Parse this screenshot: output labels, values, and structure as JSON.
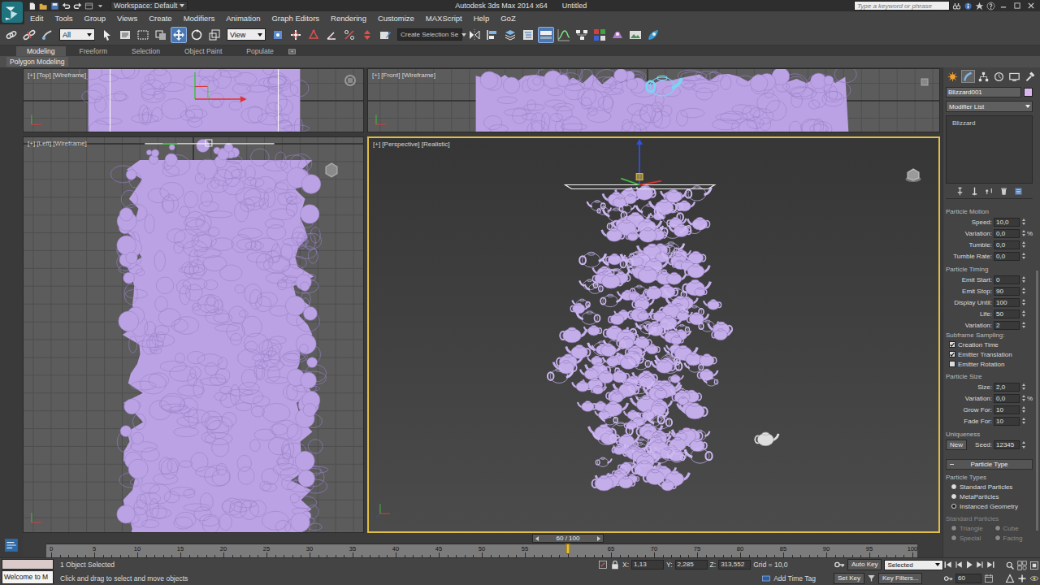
{
  "title_bar": {
    "workspace": "Workspace: Default",
    "app_title": "Autodesk 3ds Max 2014 x64",
    "document": "Untitled",
    "search_placeholder": "Type a keyword or phrase"
  },
  "menu": [
    "Edit",
    "Tools",
    "Group",
    "Views",
    "Create",
    "Modifiers",
    "Animation",
    "Graph Editors",
    "Rendering",
    "Customize",
    "MAXScript",
    "Help",
    "GoZ"
  ],
  "toolbar": {
    "selection_filter": "All",
    "reference_coord": "View",
    "named_selection": "Create Selection Se",
    "tools": [
      {
        "selected": false
      },
      {
        "selected": false
      },
      {
        "selected": false
      },
      {
        "selected": false
      },
      {
        "selected": false
      },
      {
        "selected": false
      },
      {
        "selected": false
      },
      {
        "selected": true
      },
      {
        "selected": false
      },
      {
        "selected": false
      },
      {
        "selected": false
      },
      {
        "selected": false
      },
      {
        "selected": false
      },
      {
        "selected": false
      },
      {
        "selected": false
      },
      {
        "selected": false
      },
      {
        "selected": false
      },
      {
        "selected": false
      },
      {
        "selected": false
      },
      {
        "selected": false
      },
      {
        "selected": false
      },
      {
        "selected": true
      },
      {
        "selected": false
      },
      {
        "selected": false
      },
      {
        "selected": false
      },
      {
        "selected": false
      },
      {
        "selected": false
      },
      {
        "selected": false
      }
    ]
  },
  "ribbon": {
    "tabs": [
      {
        "label": "Modeling",
        "selected": true
      },
      {
        "label": "Freeform",
        "selected": false
      },
      {
        "label": "Selection",
        "selected": false
      },
      {
        "label": "Object Paint",
        "selected": false
      },
      {
        "label": "Populate",
        "selected": false
      }
    ],
    "panel": "Polygon Modeling"
  },
  "viewports": [
    {
      "label": "[+] [Top] [Wireframe]",
      "active": false
    },
    {
      "label": "[+] [Front] [Wireframe]",
      "active": false
    },
    {
      "label": "[+] [Left] [Wireframe]",
      "active": false
    },
    {
      "label": "[+] [Perspective] [Realistic]",
      "active": true
    }
  ],
  "command_panel": {
    "tabs": [
      {
        "selected": false
      },
      {
        "selected": true
      },
      {
        "selected": false
      },
      {
        "selected": false
      },
      {
        "selected": false
      },
      {
        "selected": false
      }
    ],
    "object_name": "Blizzard001",
    "object_color": "#dcb6f0",
    "modifier_list": "Modifier List",
    "stack": [
      "Blizzard"
    ],
    "groups": [
      {
        "title": "Particle Motion",
        "rows": [
          {
            "kind": "spinner",
            "label": "Speed:",
            "value": "10,0"
          },
          {
            "kind": "spinner",
            "label": "Variation:",
            "value": "0,0",
            "unit": "%"
          },
          {
            "kind": "spinner",
            "label": "Tumble:",
            "value": "0,0"
          },
          {
            "kind": "spinner",
            "label": "Tumble Rate:",
            "value": "0,0"
          }
        ]
      },
      {
        "title": "Particle Timing",
        "rows": [
          {
            "kind": "spinner",
            "label": "Emit Start:",
            "value": "0"
          },
          {
            "kind": "spinner",
            "label": "Emit Stop:",
            "value": "90"
          },
          {
            "kind": "spinner",
            "label": "Display Until:",
            "value": "100"
          },
          {
            "kind": "spinner",
            "label": "Life:",
            "value": "50"
          },
          {
            "kind": "spinner",
            "label": "Variation:",
            "value": "2"
          },
          {
            "kind": "caption",
            "label": "Subframe Sampling:"
          },
          {
            "kind": "checkbox",
            "label": "Creation Time",
            "checked": true
          },
          {
            "kind": "checkbox",
            "label": "Emitter Translation",
            "checked": true
          },
          {
            "kind": "checkbox",
            "label": "Emitter Rotation",
            "checked": false
          }
        ]
      },
      {
        "title": "Particle Size",
        "rows": [
          {
            "kind": "spinner",
            "label": "Size:",
            "value": "2,0"
          },
          {
            "kind": "spinner",
            "label": "Variation:",
            "value": "0,0",
            "unit": "%"
          },
          {
            "kind": "spinner",
            "label": "Grow For:",
            "value": "10"
          },
          {
            "kind": "spinner",
            "label": "Fade For:",
            "value": "10"
          }
        ]
      },
      {
        "title": "Uniqueness",
        "rows": [
          {
            "kind": "seed",
            "button": "New",
            "label": "Seed:",
            "value": "12345"
          }
        ]
      }
    ],
    "rollout": "Particle Type",
    "type_groups": [
      {
        "title": "Particle Types",
        "disabled": false,
        "rows": [
          {
            "kind": "radio",
            "label": "Standard Particles",
            "selected": false
          },
          {
            "kind": "radio",
            "label": "MetaParticles",
            "selected": false
          },
          {
            "kind": "radio",
            "label": "Instanced Geometry",
            "selected": true
          }
        ]
      },
      {
        "title": "Standard Particles",
        "disabled": true,
        "rows": [
          {
            "kind": "radio_pair",
            "items": [
              {
                "label": "Triangle",
                "selected": false
              },
              {
                "label": "Cube",
                "selected": false
              }
            ]
          },
          {
            "kind": "radio_pair",
            "items": [
              {
                "label": "Special",
                "selected": false
              },
              {
                "label": "Facing",
                "selected": false
              }
            ]
          }
        ]
      }
    ]
  },
  "timeline": {
    "frame_label": "60 / 100",
    "level": 0.6,
    "ticks": [
      "0",
      "5",
      "10",
      "15",
      "20",
      "25",
      "30",
      "35",
      "40",
      "45",
      "50",
      "55",
      "65",
      "70",
      "75",
      "80",
      "85",
      "90",
      "95",
      "100"
    ]
  },
  "status_bar": {
    "welcome": "Welcome to M",
    "selection": "1 Object Selected",
    "prompt": "Click and drag to select and move objects",
    "coords": [
      {
        "axis": "X:",
        "value": "1,13"
      },
      {
        "axis": "Y:",
        "value": "2,285"
      },
      {
        "axis": "Z:",
        "value": "313,552"
      }
    ],
    "grid": "Grid = 10,0",
    "time_tag": "Add Time Tag",
    "auto_key": "Auto Key",
    "key_mode": "Selected",
    "set_key": "Set Key",
    "key_filters": "Key Filters...",
    "frame": "60"
  }
}
